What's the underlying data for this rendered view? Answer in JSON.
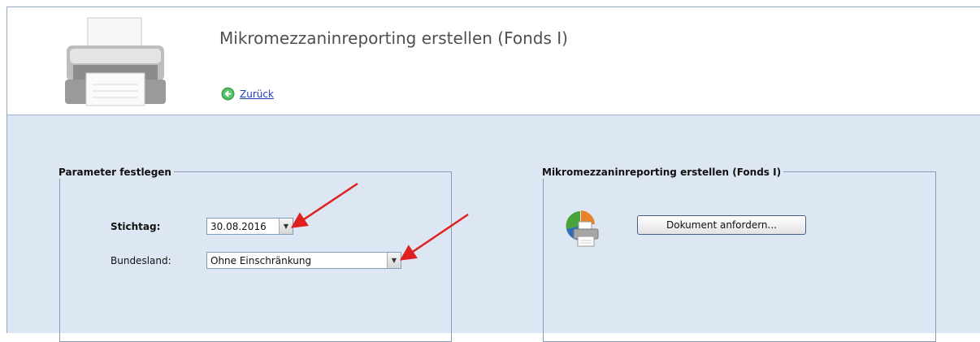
{
  "header": {
    "title": "Mikromezzaninreporting erstellen (Fonds I)",
    "back_label": "Zurück",
    "icons": {
      "main": "printer-icon",
      "back": "back-arrow-icon"
    }
  },
  "parameters": {
    "legend": "Parameter festlegen",
    "stichtag_label": "Stichtag:",
    "stichtag_value": "30.08.2016",
    "bundesland_label": "Bundesland:",
    "bundesland_value": "Ohne Einschränkung"
  },
  "report": {
    "legend": "Mikromezzaninreporting erstellen (Fonds I)",
    "button_label": "Dokument anfordern...",
    "icon": "chart-printer-icon"
  },
  "colors": {
    "content_bg": "#dde7f3",
    "link": "#1f3fb8",
    "annotation_arrow": "#e02020"
  }
}
